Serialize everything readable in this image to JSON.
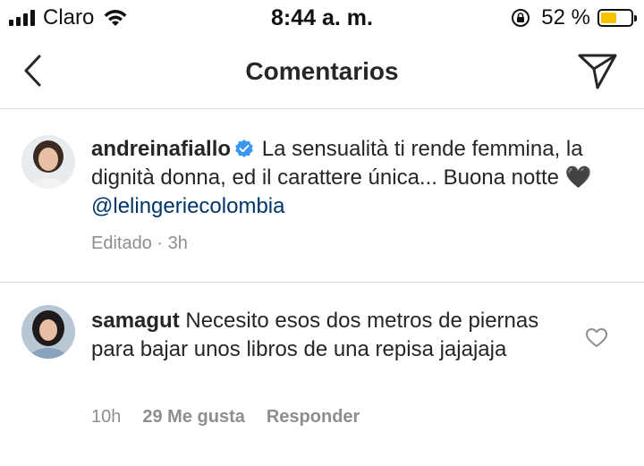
{
  "status_bar": {
    "carrier": "Claro",
    "time": "8:44 a. m.",
    "battery_percent": "52 %",
    "battery_level": 0.52,
    "battery_color": "#f5c400"
  },
  "header": {
    "title": "Comentarios",
    "back_icon": "chevron-left-icon",
    "send_icon": "paper-plane-icon"
  },
  "caption": {
    "username": "andreinafiallo",
    "verified": true,
    "text": "La sensualità ti rende femmina, la dignità donna, ed il carattere única... Buona notte",
    "emoji": "🖤",
    "mention": "@lelingeriecolombia",
    "meta": "Editado · 3h"
  },
  "comment": {
    "username": "samagut",
    "text": "Necesito esos dos metros de piernas para bajar unos libros de una repisa jajajaja",
    "time": "10h",
    "likes": "29 Me gusta",
    "reply": "Responder"
  },
  "colors": {
    "mention": "#003569",
    "verified": "#3897f0",
    "meta": "#8e8e8e",
    "divider": "#dbdbdb"
  }
}
